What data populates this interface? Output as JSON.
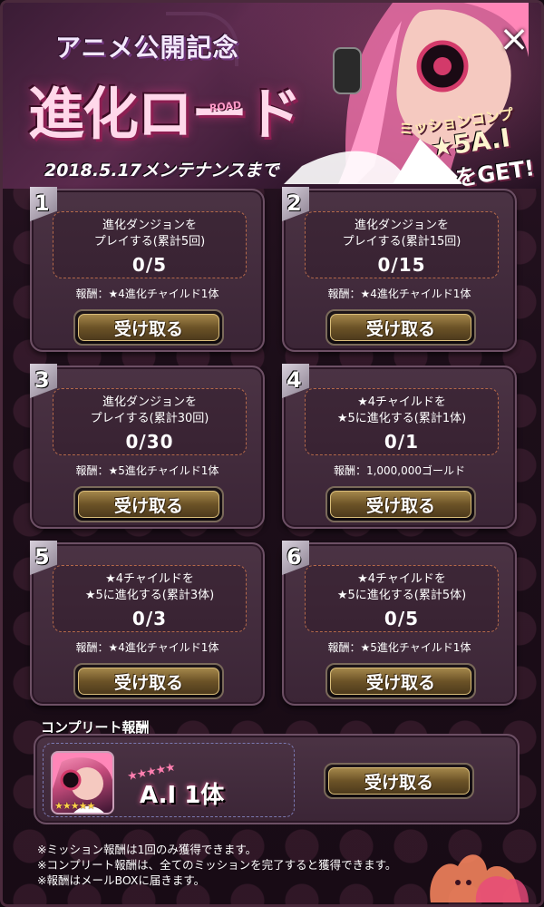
{
  "header": {
    "subtitle": "アニメ公開記念",
    "title": "進化ロード",
    "title_road": "ROAD",
    "deadline": "2018.5.17メンテナンスまで",
    "promo_line1": "ミッションコンプ",
    "promo_line2": "★5A.I",
    "promo_line3": "をGET!",
    "close_label": "×"
  },
  "missions": [
    {
      "number": "1",
      "desc": "進化ダンジョンを\nプレイする(累計5回)",
      "progress": "0/5",
      "reward": "報酬：★4進化チャイルド1体",
      "button": "受け取る"
    },
    {
      "number": "2",
      "desc": "進化ダンジョンを\nプレイする(累計15回)",
      "progress": "0/15",
      "reward": "報酬：★4進化チャイルド1体",
      "button": "受け取る"
    },
    {
      "number": "3",
      "desc": "進化ダンジョンを\nプレイする(累計30回)",
      "progress": "0/30",
      "reward": "報酬：★5進化チャイルド1体",
      "button": "受け取る"
    },
    {
      "number": "4",
      "desc": "★4チャイルドを\n★5に進化する(累計1体)",
      "progress": "0/1",
      "reward": "報酬：1,000,000ゴールド",
      "button": "受け取る"
    },
    {
      "number": "5",
      "desc": "★4チャイルドを\n★5に進化する(累計3体)",
      "progress": "0/3",
      "reward": "報酬：★4進化チャイルド1体",
      "button": "受け取る"
    },
    {
      "number": "6",
      "desc": "★4チャイルドを\n★5に進化する(累計5体)",
      "progress": "0/5",
      "reward": "報酬：★5進化チャイルド1体",
      "button": "受け取る"
    }
  ],
  "complete": {
    "label": "コンプリート報酬",
    "reward_name": "A.I 1体",
    "reward_stars": "★★★★★",
    "avatar_stars": "★★★★★",
    "button": "受け取る"
  },
  "notes": [
    "※ミッション報酬は1回のみ獲得できます。",
    "※コンプリート報酬は、全てのミッションを完了すると獲得できます。",
    "※報酬はメールBOXに届きます。"
  ],
  "colors": {
    "background": "#1c0e19",
    "card": "#432c3d",
    "button_gold": "#8c6f38",
    "accent_pink": "#ff7fb0"
  }
}
